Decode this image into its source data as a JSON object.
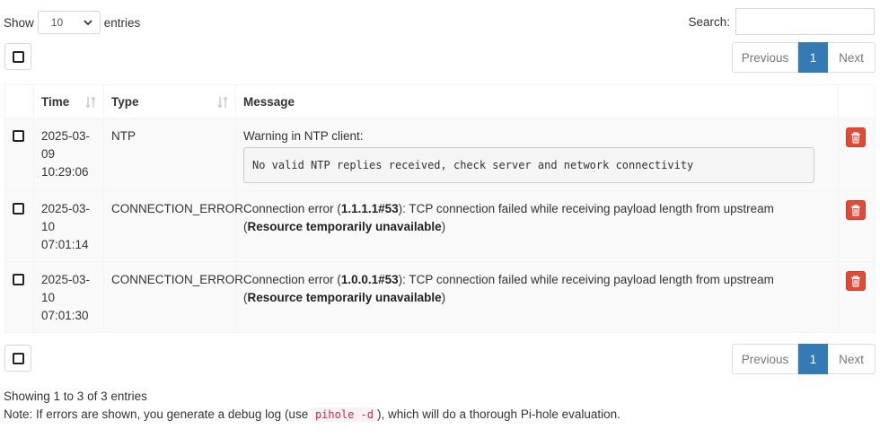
{
  "controls": {
    "show_label": "Show",
    "entries_value": "10",
    "entries_label": "entries",
    "search_label": "Search:",
    "search_value": ""
  },
  "pagination": {
    "previous": "Previous",
    "current": "1",
    "next": "Next"
  },
  "table": {
    "headers": {
      "time": "Time",
      "type": "Type",
      "message": "Message"
    },
    "rows": [
      {
        "time": [
          "2025-03-",
          "09",
          "10:29:06"
        ],
        "type": "NTP",
        "message": {
          "text": "Warning in NTP client:",
          "detail": "No valid NTP replies received, check server and network connectivity"
        }
      },
      {
        "time": [
          "2025-03-",
          "10",
          "07:01:14"
        ],
        "type": "CONNECTION_ERROR",
        "message": {
          "pre": "Connection error (",
          "server": "1.1.1.1#53",
          "mid": "): TCP connection failed while receiving payload length from upstream (",
          "reason": "Resource temporarily unavailable",
          "post": ")"
        }
      },
      {
        "time": [
          "2025-03-",
          "10",
          "07:01:30"
        ],
        "type": "CONNECTION_ERROR",
        "message": {
          "pre": "Connection error (",
          "server": "1.0.0.1#53",
          "mid": "): TCP connection failed while receiving payload length from upstream (",
          "reason": "Resource temporarily unavailable",
          "post": ")"
        }
      }
    ]
  },
  "footer": {
    "info": "Showing 1 to 3 of 3 entries",
    "note_pre": "Note: If errors are shown, you generate a debug log (use ",
    "note_code": "pihole -d",
    "note_post": "), which will do a thorough Pi-hole evaluation."
  },
  "colors": {
    "primary": "#337ab7",
    "danger": "#dd4b39",
    "code": "#c7254e"
  },
  "icons": {
    "sort": "sort-icon",
    "delete": "trash-icon",
    "dropdown": "chevron-down-icon"
  }
}
